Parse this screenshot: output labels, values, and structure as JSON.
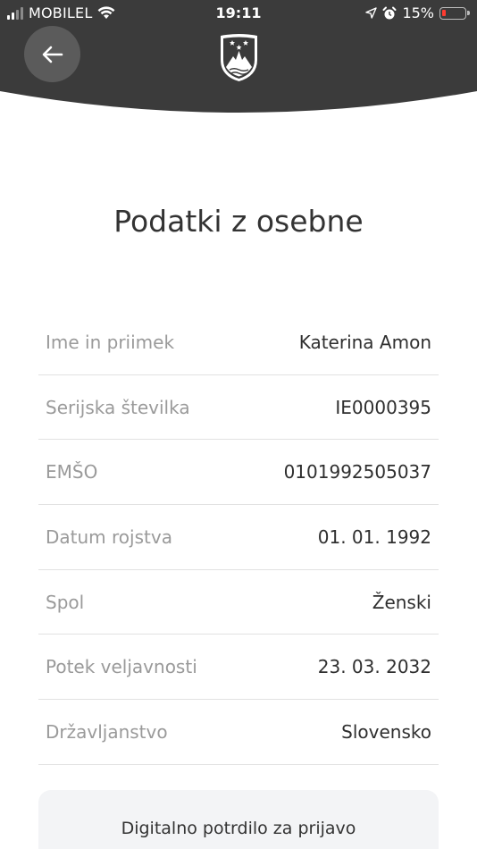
{
  "status_bar": {
    "carrier": "MOBILEL",
    "time": "19:11",
    "battery_percent": "15%",
    "battery_level": 0.15,
    "battery_color": "#ff3b30"
  },
  "header": {
    "background_color": "#3b3b3b",
    "back_icon": "arrow-left-icon",
    "emblem": "coat-of-arms-slovenia"
  },
  "page": {
    "title": "Podatki z osebne"
  },
  "rows": [
    {
      "label": "Ime in priimek",
      "value": "Katerina Amon"
    },
    {
      "label": "Serijska številka",
      "value": "IE0000395"
    },
    {
      "label": "EMŠO",
      "value": "0101992505037"
    },
    {
      "label": "Datum rojstva",
      "value": "01. 01. 1992"
    },
    {
      "label": "Spol",
      "value": "Ženski"
    },
    {
      "label": "Potek veljavnosti",
      "value": "23. 03. 2032"
    },
    {
      "label": "Državljanstvo",
      "value": "Slovensko"
    }
  ],
  "certificate": {
    "label": "Digitalno potrdilo za prijavo"
  }
}
